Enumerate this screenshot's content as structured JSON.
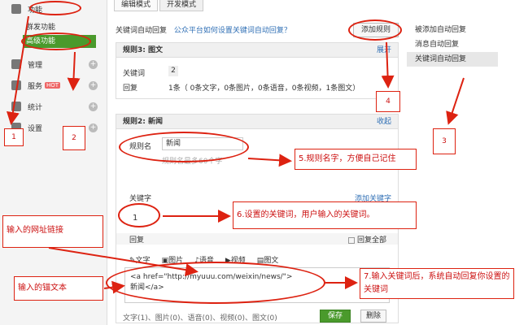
{
  "sidebar": {
    "top_item": "功能",
    "sub_items": [
      "群发功能",
      "高级功能"
    ],
    "items": [
      {
        "label": "管理"
      },
      {
        "label": "服务",
        "badge": "HOT"
      },
      {
        "label": "统计"
      },
      {
        "label": "设置"
      }
    ]
  },
  "tabs": [
    "编辑模式",
    "开发模式"
  ],
  "header": {
    "title": "关键词自动回复",
    "help_link": "公众平台如何设置关键词自动回复？",
    "add_rule_button": "添加规则"
  },
  "rule3": {
    "title": "规则3: 图文",
    "expand": "展开",
    "keyword_label": "关键词",
    "keyword_count": "2",
    "reply_label": "回复",
    "reply_summary": "1条（ 0条文字，0条图片，0条语音，0条视频，1条图文）"
  },
  "rule2": {
    "title": "规则2: 新闻",
    "collapse": "收起",
    "name_label": "规则名",
    "name_value": "新闻",
    "name_hint": "规则名最多60个字",
    "keyword_label": "关键字",
    "add_keyword": "添加关键字",
    "keyword_value": "1",
    "reply_label": "回复",
    "reply_all_label": "回复全部",
    "toolbar": [
      "文字",
      "图片",
      "语音",
      "视频",
      "图文"
    ],
    "reply_content_line1": "<a href=\"http://myuuu.com/weixin/news/\">",
    "reply_content_line2": "新闻</a>",
    "footer_counts": "文字(1)、图片(0)、语音(0)、视频(0)、图文(0)",
    "save_button": "保存",
    "delete_button": "删除"
  },
  "right_list": {
    "items": [
      "被添加自动回复",
      "消息自动回复",
      "关键词自动回复"
    ],
    "active_index": 2
  },
  "annotations": {
    "n1": "1",
    "n2": "2",
    "n3": "3",
    "n4": "4",
    "n5": "5.规则名字，方便自己记住",
    "n6": "6.设置的关键词，用户输入的关键词。",
    "n7": "7.输入关键词后，系统自动回复你设置的关键词",
    "url_label": "输入的网址链接",
    "anchor_label": "输入的锚文本"
  },
  "colors": {
    "accent_green": "#4a9a2c",
    "annotation_red": "#d21",
    "link_blue": "#2f6fb5"
  }
}
